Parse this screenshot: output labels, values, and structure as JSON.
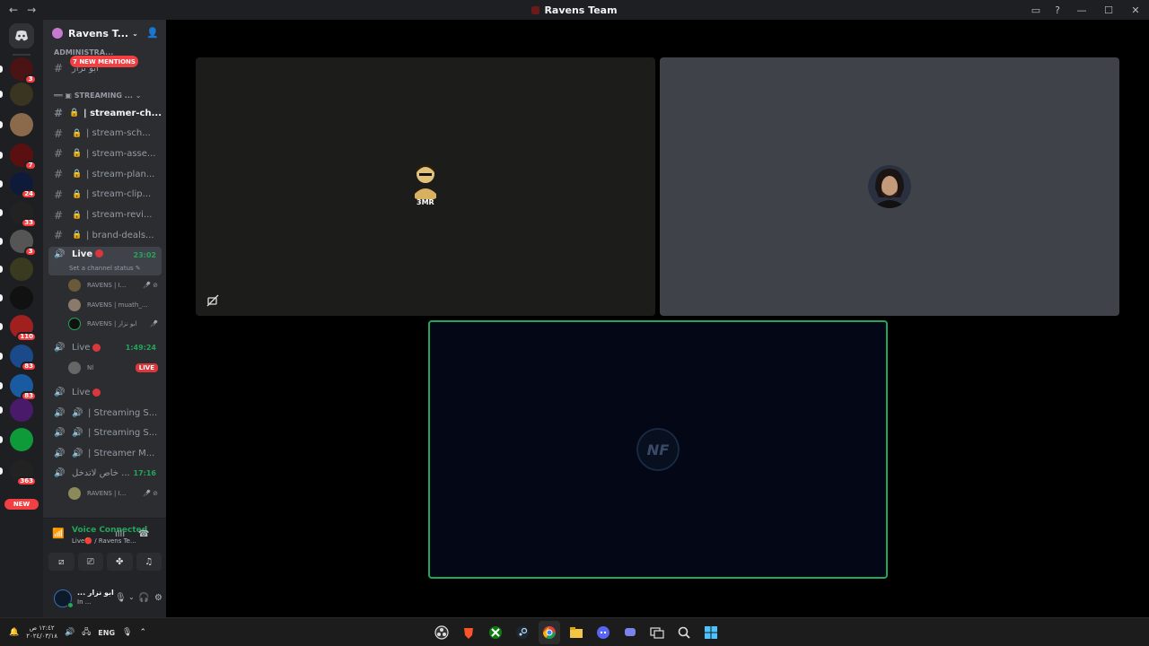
{
  "window": {
    "title": "Ravens Team",
    "back": "←",
    "forward": "→",
    "inbox_icon": "▭",
    "help_icon": "?",
    "min": "—",
    "max": "☐",
    "close": "✕"
  },
  "rail": {
    "home_icon": "discord-logo",
    "new_label": "NEW",
    "servers": [
      {
        "badge": "3",
        "color": "#4a1414"
      },
      {
        "badge": "",
        "color": "#3a3520"
      },
      {
        "badge": "",
        "color": "#8a6a4a"
      },
      {
        "badge": "7",
        "color": "#5a1010"
      },
      {
        "badge": "24",
        "color": "#0d1a3a"
      },
      {
        "badge": "33",
        "color": "#222"
      },
      {
        "badge": "3",
        "color": "#555"
      },
      {
        "badge": "",
        "color": "#3a3a20"
      },
      {
        "badge": "",
        "color": "#111"
      },
      {
        "badge": "110",
        "color": "#a02020"
      },
      {
        "badge": "83",
        "color": "#1a4a8a"
      },
      {
        "badge": "83",
        "color": "#1a5aa0"
      },
      {
        "badge": "",
        "color": "#4a1a6a"
      },
      {
        "badge": "",
        "color": "#0f9a3a"
      },
      {
        "badge": "363",
        "color": "#222"
      }
    ]
  },
  "sidebar": {
    "guild_name": "Ravens T...",
    "mentions_pill": "7 NEW MENTIONS",
    "cat_admin": "ADMINISTRA...",
    "admin_channel": "ابو نزار",
    "cat_streaming": "STREAMING ...",
    "channels": [
      {
        "name": "| streamer-ch...",
        "active": true
      },
      {
        "name": "| stream-sch..."
      },
      {
        "name": "| stream-asse..."
      },
      {
        "name": "| stream-plan..."
      },
      {
        "name": "| stream-clip..."
      },
      {
        "name": "| stream-revi..."
      },
      {
        "name": "| brand-deals..."
      }
    ],
    "live1": {
      "name": "Live",
      "time": "23:02",
      "status": "Set a channel status ✎"
    },
    "live1_users": [
      {
        "name": "RAVENS | I...",
        "icons": "🎤̸ ⊘"
      },
      {
        "name": "RAVENS | muath_..."
      },
      {
        "name": "RAVENS | ابو نزار",
        "icons": "🎤̸"
      }
    ],
    "live2": {
      "name": "Live",
      "time": "1:49:24"
    },
    "live2_user": {
      "name": "Nl",
      "badge": "LIVE"
    },
    "live3": {
      "name": "Live"
    },
    "voice_channels": [
      {
        "name": "| Streaming S..."
      },
      {
        "name": "| Streaming S..."
      },
      {
        "name": "| Streamer M..."
      }
    ],
    "private": {
      "name": "خاص لاتدخل ...",
      "time": "17:16"
    },
    "private_user": {
      "name": "RAVENS | I...",
      "icons": "🎤̸ ⊘"
    }
  },
  "voice_panel": {
    "title": "Voice Connected",
    "subtitle": "Live🔴 / Ravens Te...",
    "noise_icon": "ıllı",
    "disconnect_icon": "☎"
  },
  "user_panel": {
    "name": "... ابو نزار",
    "status": "In ...",
    "mic": "🎙",
    "headset": "🎧",
    "gear": "⚙",
    "chevron": "⌄"
  },
  "stage": {
    "tile1_tag": "3MR"
  },
  "taskbar": {
    "time": "١٢:٤٢ ص",
    "date": "٢٠٢٤/٠٣/١٨",
    "lang": "ENG"
  }
}
